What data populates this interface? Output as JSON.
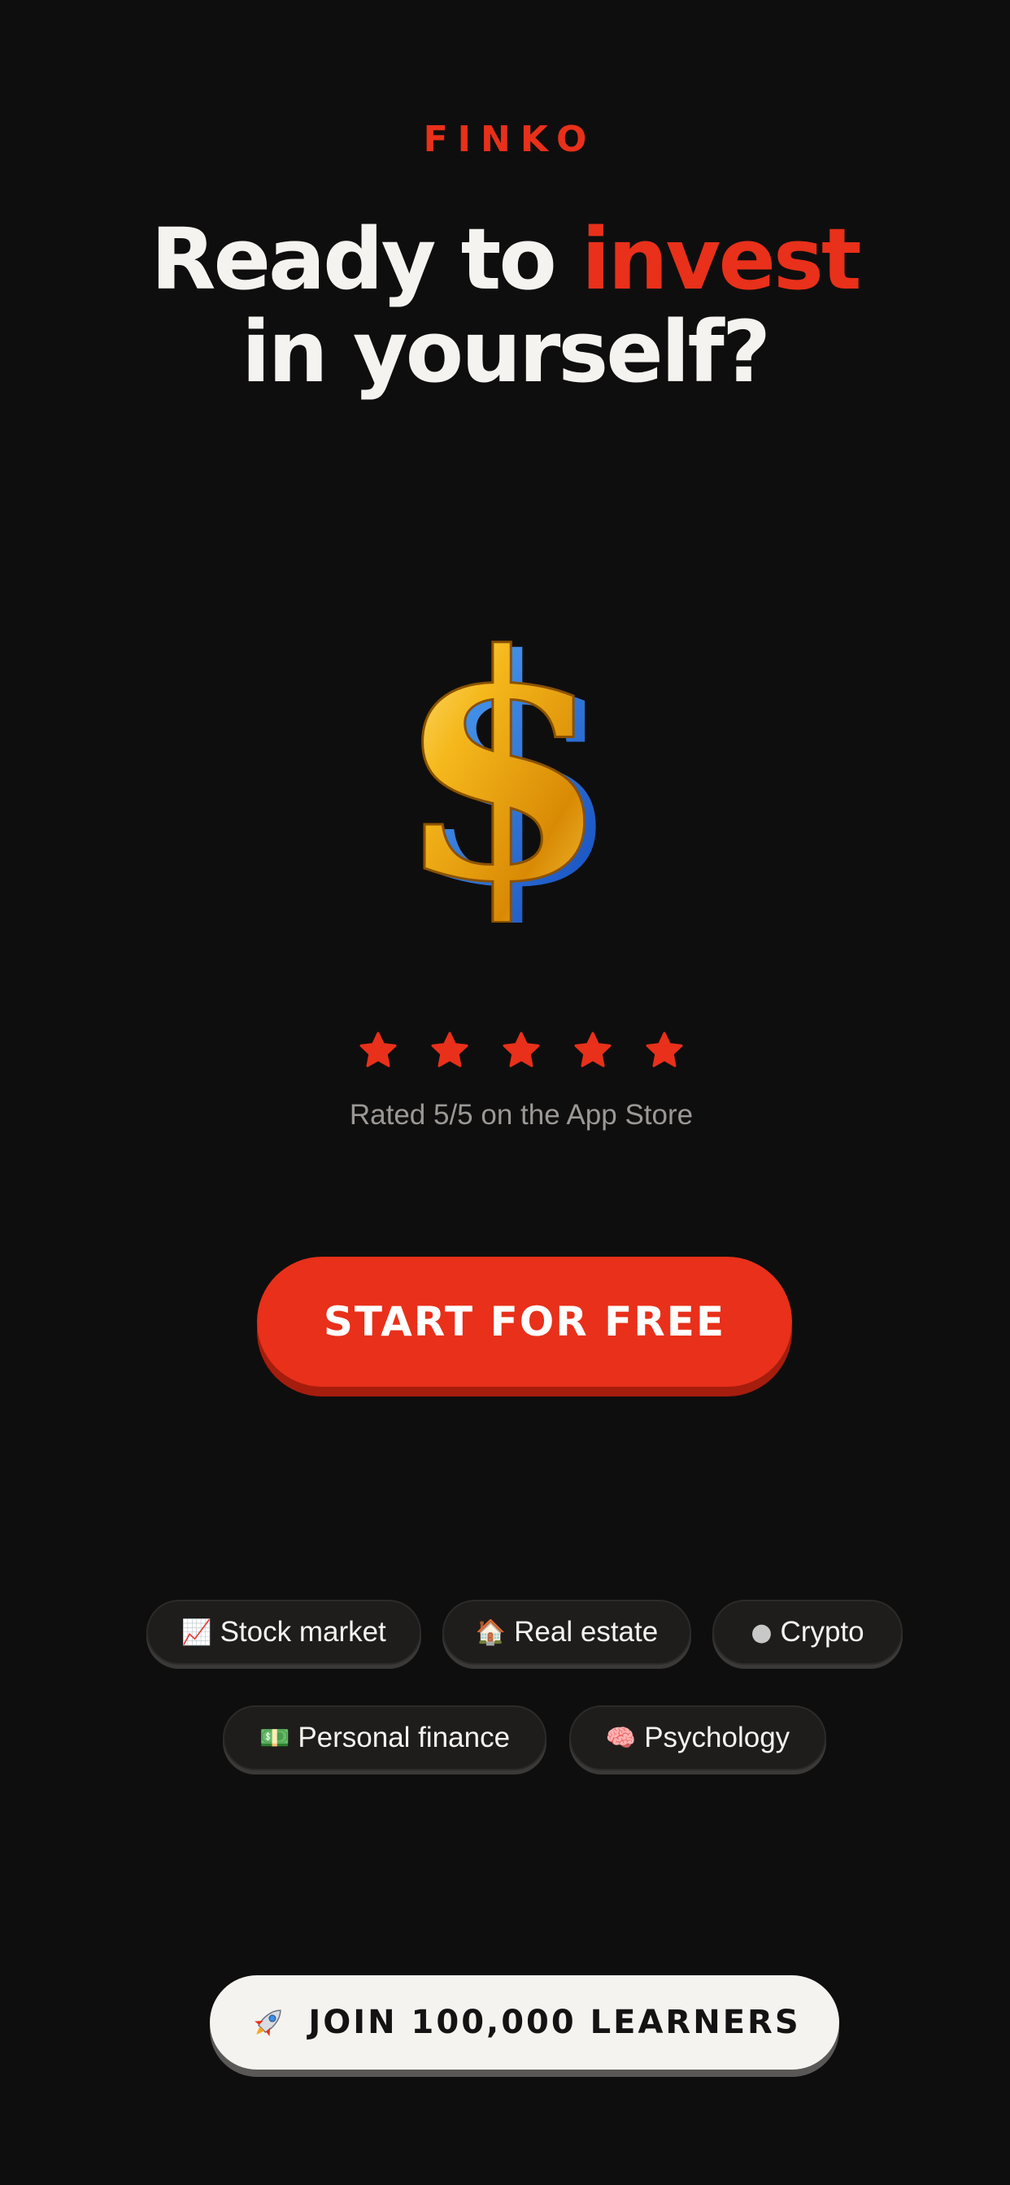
{
  "brand": {
    "name": "FINKO"
  },
  "hero": {
    "headline_part1": "Ready to ",
    "headline_accent": "invest",
    "headline_part2": "in yourself?"
  },
  "rating": {
    "stars": 5,
    "max_stars": 5,
    "text": "Rated 5/5 on the App Store"
  },
  "cta": {
    "label": "START FOR FREE"
  },
  "topics": [
    {
      "icon": "chart-increasing-icon",
      "label": "Stock market"
    },
    {
      "icon": "house-icon",
      "label": "Real estate"
    },
    {
      "icon": "moon-icon",
      "label": "Crypto"
    },
    {
      "icon": "dollar-banknote-icon",
      "label": "Personal finance"
    },
    {
      "icon": "brain-icon",
      "label": "Psychology"
    }
  ],
  "join": {
    "icon": "rocket-icon",
    "label": "JOIN 100,000 LEARNERS"
  },
  "colors": {
    "background": "#0f0e0e",
    "accent": "#e8301a",
    "text": "#f5f3ef",
    "muted": "#9b9895"
  }
}
